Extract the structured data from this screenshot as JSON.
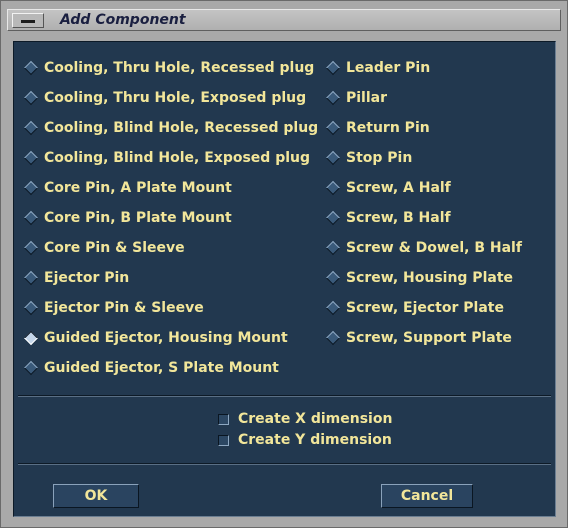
{
  "window": {
    "title": "Add Component"
  },
  "options_left": [
    {
      "label": "Cooling, Thru Hole, Recessed plug",
      "selected": false
    },
    {
      "label": "Cooling, Thru Hole, Exposed plug",
      "selected": false
    },
    {
      "label": "Cooling, Blind Hole, Recessed plug",
      "selected": false
    },
    {
      "label": "Cooling, Blind Hole, Exposed plug",
      "selected": false
    },
    {
      "label": "Core Pin, A Plate Mount",
      "selected": false
    },
    {
      "label": "Core Pin, B Plate Mount",
      "selected": false
    },
    {
      "label": "Core Pin & Sleeve",
      "selected": false
    },
    {
      "label": "Ejector Pin",
      "selected": false
    },
    {
      "label": "Ejector Pin & Sleeve",
      "selected": false
    },
    {
      "label": "Guided Ejector, Housing Mount",
      "selected": true
    },
    {
      "label": "Guided Ejector, S Plate Mount",
      "selected": false
    }
  ],
  "options_right": [
    {
      "label": "Leader Pin",
      "selected": false
    },
    {
      "label": "Pillar",
      "selected": false
    },
    {
      "label": "Return Pin",
      "selected": false
    },
    {
      "label": "Stop Pin",
      "selected": false
    },
    {
      "label": "Screw, A Half",
      "selected": false
    },
    {
      "label": "Screw, B Half",
      "selected": false
    },
    {
      "label": "Screw & Dowel, B Half",
      "selected": false
    },
    {
      "label": "Screw, Housing Plate",
      "selected": false
    },
    {
      "label": "Screw, Ejector Plate",
      "selected": false
    },
    {
      "label": "Screw, Support Plate",
      "selected": false
    }
  ],
  "checkboxes": [
    {
      "label": "Create X dimension",
      "checked": false
    },
    {
      "label": "Create Y dimension",
      "checked": false
    }
  ],
  "buttons": {
    "ok": "OK",
    "cancel": "Cancel"
  },
  "colors": {
    "panel": "#22384f",
    "label_text": "#f2e69a",
    "frame": "#a9a9a9",
    "title_text": "#1a1f40"
  },
  "icons": {
    "window_menu": "window-menu-icon",
    "radio": "diamond-radio-icon",
    "checkbox": "checkbox-icon"
  }
}
